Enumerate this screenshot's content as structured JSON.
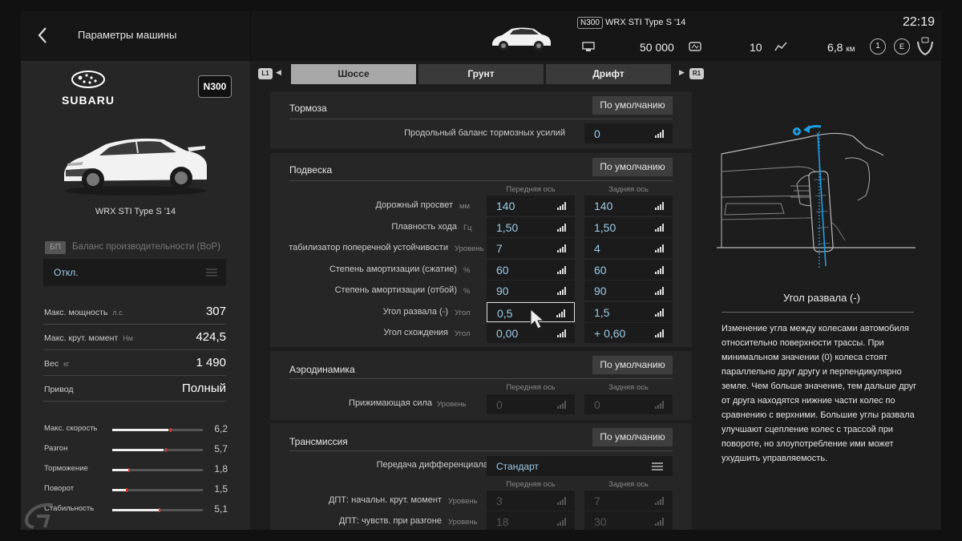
{
  "header": {
    "title": "Параметры машины",
    "rating": "N300",
    "car_name": "WRX STI Type S '14",
    "time": "22:19",
    "credits": "50 000",
    "level": "10",
    "distance": "6,8",
    "distance_unit": "км",
    "badge1": "1",
    "badge2": "E"
  },
  "left": {
    "brand": "SUBARU",
    "rating": "N300",
    "car_name": "WRX STI Type S '14",
    "bop_tag": "БП",
    "bop_label": "Баланс производительности (BoP)",
    "bop_value": "Откл.",
    "specs": [
      {
        "label": "Макс. мощность",
        "unit": "л.с.",
        "value": "307"
      },
      {
        "label": "Макс. крут. момент",
        "unit": "Нм",
        "value": "424,5"
      },
      {
        "label": "Вес",
        "unit": "кг",
        "value": "1 490"
      },
      {
        "label": "Привод",
        "unit": "",
        "value": "Полный"
      }
    ],
    "perf": [
      {
        "label": "Макс. скорость",
        "value": "6,2",
        "fill": 0.62
      },
      {
        "label": "Разгон",
        "value": "5,7",
        "fill": 0.57
      },
      {
        "label": "Торможение",
        "value": "1,8",
        "fill": 0.18
      },
      {
        "label": "Поворот",
        "value": "1,5",
        "fill": 0.15
      },
      {
        "label": "Стабильность",
        "value": "5,1",
        "fill": 0.51
      }
    ]
  },
  "tabs": {
    "l1": "L1",
    "r1": "R1",
    "items": [
      "Шоссе",
      "Грунт",
      "Дрифт"
    ]
  },
  "default_label": "По умолчанию",
  "front_axle": "Передняя ось",
  "rear_axle": "Задняя ось",
  "brakes": {
    "title": "Тормоза",
    "rows": [
      {
        "label": "Продольный баланс тормозных усилий",
        "value": "0"
      }
    ]
  },
  "suspension": {
    "title": "Подвеска",
    "rows": [
      {
        "label": "Дорожный просвет",
        "unit": "мм",
        "front": "140",
        "rear": "140"
      },
      {
        "label": "Плавность хода",
        "unit": "Гц",
        "front": "1,50",
        "rear": "1,50"
      },
      {
        "label": "табилизатор поперечной устойчивости",
        "unit": "Уровень",
        "front": "7",
        "rear": "4"
      },
      {
        "label": "Степень амортизации (сжатие)",
        "unit": "%",
        "front": "60",
        "rear": "60"
      },
      {
        "label": "Степень амортизации (отбой)",
        "unit": "%",
        "front": "90",
        "rear": "90"
      },
      {
        "label": "Угол развала (-)",
        "unit": "Угол",
        "front": "0,5",
        "rear": "1,5"
      },
      {
        "label": "Угол схождения",
        "unit": "Угол",
        "front": "0,00",
        "rear": "+ 0,60"
      }
    ]
  },
  "aero": {
    "title": "Аэродинамика",
    "rows": [
      {
        "label": "Прижимающая сила",
        "unit": "Уровень",
        "front": "0",
        "rear": "0"
      }
    ]
  },
  "transmission": {
    "title": "Трансмиссия",
    "diff_label": "Передача дифференциала",
    "diff_value": "Стандарт",
    "rows": [
      {
        "label": "ДПТ: начальн. крут. момент",
        "unit": "Уровень",
        "front": "3",
        "rear": "7"
      },
      {
        "label": "ДПТ: чувств. при разгоне",
        "unit": "Уровень",
        "front": "18",
        "rear": "30"
      }
    ]
  },
  "description": {
    "title": "Угол развала (-)",
    "text": "Изменение угла между колесами автомобиля относительно поверхности трассы. При минимальном значении (0) колеса стоят параллельно друг другу и перпендикулярно земле. Чем больше значение, тем дальше друг от друга находятся нижние части колес по сравнению с верхними. Большие углы развала улучшают сцепление колес с трассой при повороте, но злоупотребление ими может ухудшить управляемость."
  },
  "colors": {
    "value_text": "#9ecbe6",
    "accent_blue": "#1e9fe6",
    "mark_red": "#d33333"
  }
}
